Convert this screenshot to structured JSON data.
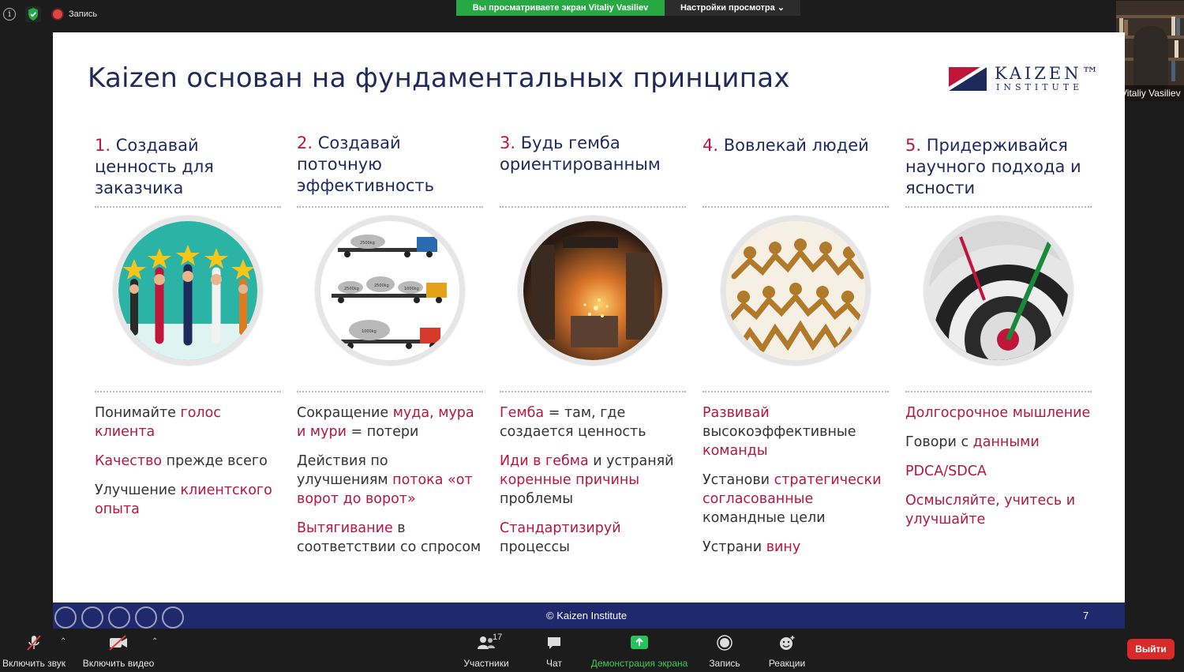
{
  "meeting": {
    "recording_label": "Запись",
    "share_banner": "Вы просматриваете экран Vitaliy Vasiliev",
    "view_options": "Настройки просмотра ⌄",
    "participant_name": "Vitaliy Vasiliev"
  },
  "slide": {
    "title": "Kaizen основан на фундаментальных принципах",
    "logo_main": "KAIZEN™",
    "logo_sub": "INSTITUTE",
    "footer": "© Kaizen Institute",
    "page": "7",
    "columns": [
      {
        "num": "1.",
        "head": "Создавай ценность для заказчика",
        "bullets": [
          [
            {
              "t": "Понимайте ",
              "h": false
            },
            {
              "t": "голос клиента",
              "h": true
            }
          ],
          [
            {
              "t": "Качество",
              "h": true
            },
            {
              "t": " прежде всего",
              "h": false
            }
          ],
          [
            {
              "t": "Улучшение ",
              "h": false
            },
            {
              "t": "клиентского опыта",
              "h": true
            }
          ]
        ]
      },
      {
        "num": "2.",
        "head": "Создавай поточную эффективность",
        "bullets": [
          [
            {
              "t": "Сокращение ",
              "h": false
            },
            {
              "t": "муда, мура и мури",
              "h": true
            },
            {
              "t": " = потери",
              "h": false
            }
          ],
          [
            {
              "t": "Действия по улучшениям ",
              "h": false
            },
            {
              "t": "потока «от ворот до ворот»",
              "h": true
            }
          ],
          [
            {
              "t": "Вытягивание",
              "h": true
            },
            {
              "t": " в соответствии со спросом",
              "h": false
            }
          ]
        ]
      },
      {
        "num": "3.",
        "head": "Будь гемба ориентированным",
        "bullets": [
          [
            {
              "t": "Гемба",
              "h": true
            },
            {
              "t": " = там, где создается ценность",
              "h": false
            }
          ],
          [
            {
              "t": "Иди в гебма",
              "h": true
            },
            {
              "t": " и устраняй ",
              "h": false
            },
            {
              "t": "коренные причины",
              "h": true
            },
            {
              "t": " проблемы",
              "h": false
            }
          ],
          [
            {
              "t": "Стандартизируй",
              "h": true
            },
            {
              "t": " процессы",
              "h": false
            }
          ]
        ]
      },
      {
        "num": "4.",
        "head": "Вовлекай людей",
        "bullets": [
          [
            {
              "t": "Развивай",
              "h": true
            },
            {
              "t": " высокоэффективные ",
              "h": false
            },
            {
              "t": "команды",
              "h": true
            }
          ],
          [
            {
              "t": "Установи ",
              "h": false
            },
            {
              "t": "стратегически согласованные",
              "h": true
            },
            {
              "t": " командные цели",
              "h": false
            }
          ],
          [
            {
              "t": "Устрани ",
              "h": false
            },
            {
              "t": "вину",
              "h": true
            }
          ]
        ]
      },
      {
        "num": "5.",
        "head": "Придерживайся научного подхода и ясности",
        "bullets": [
          [
            {
              "t": "Долгосрочное мышление",
              "h": true
            }
          ],
          [
            {
              "t": "Говори с ",
              "h": false
            },
            {
              "t": "данными",
              "h": true
            }
          ],
          [
            {
              "t": "PDCA/SDCA",
              "h": true
            }
          ],
          [
            {
              "t": "Осмысляйте, учитесь и улучшайте",
              "h": true
            }
          ]
        ]
      }
    ],
    "truck_labels": [
      "2500kg",
      "2500kg",
      "2500kg",
      "1000kg",
      "1000kg"
    ]
  },
  "toolbar": {
    "mute": "Включить звук",
    "video": "Включить видео",
    "participants": "Участники",
    "participants_count": "17",
    "chat": "Чат",
    "share": "Демонстрация экрана",
    "record": "Запись",
    "reactions": "Реакции",
    "exit": "Выйти"
  },
  "colors": {
    "accent_red": "#b5173f",
    "navy": "#1f2a5c",
    "share_green": "#27a845",
    "exit_red": "#d92a2a"
  }
}
